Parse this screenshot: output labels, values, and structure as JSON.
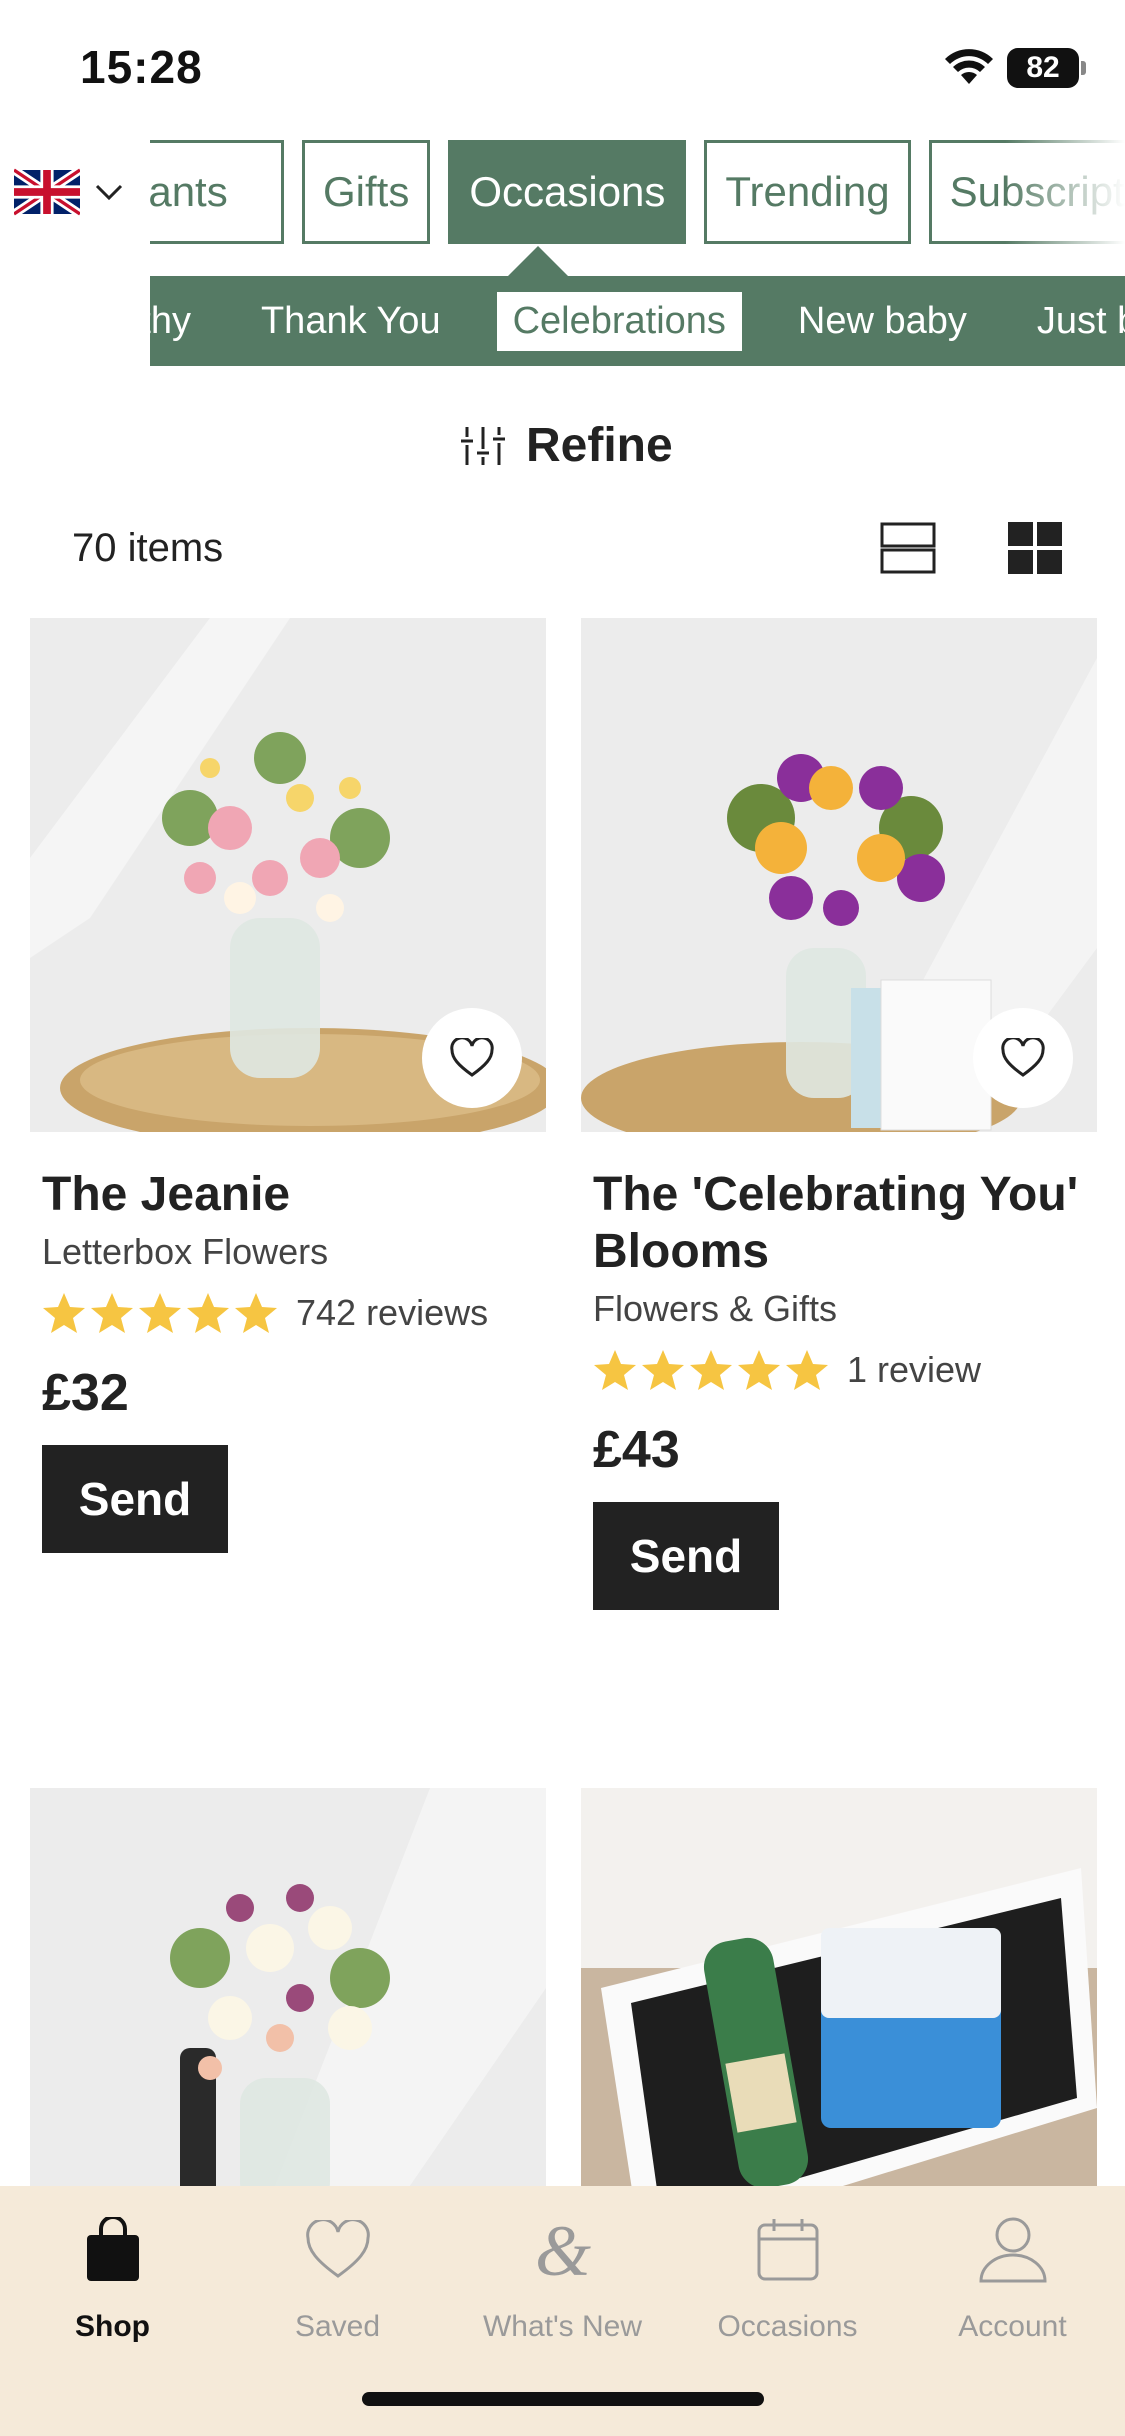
{
  "status_bar": {
    "time": "15:28",
    "battery": "82"
  },
  "colors": {
    "brand_green": "#557a64",
    "tabbar_bg": "#f5ead9",
    "star": "#f6c542"
  },
  "categories": [
    {
      "label": "Plants",
      "active": false
    },
    {
      "label": "Gifts",
      "active": false
    },
    {
      "label": "Occasions",
      "active": true
    },
    {
      "label": "Trending",
      "active": false
    },
    {
      "label": "Subscriptions",
      "active": false
    }
  ],
  "subcategories": [
    {
      "label": "Sympathy",
      "active": false
    },
    {
      "label": "Thank You",
      "active": false
    },
    {
      "label": "Celebrations",
      "active": true
    },
    {
      "label": "New baby",
      "active": false
    },
    {
      "label": "Just because",
      "active": false
    }
  ],
  "refine": {
    "label": "Refine"
  },
  "listing": {
    "items_count": "70 items"
  },
  "products": [
    {
      "title": "The Jeanie",
      "subtitle": "Letterbox Flowers",
      "rating": 5,
      "reviews": "742 reviews",
      "price": "£32",
      "cta": "Send"
    },
    {
      "title": "The 'Celebrating You' Blooms",
      "subtitle": "Flowers & Gifts",
      "rating": 5,
      "reviews": "1 review",
      "price": "£43",
      "cta": "Send"
    }
  ],
  "tabbar": {
    "shop": "Shop",
    "saved": "Saved",
    "whats_new": "What's New",
    "occasions": "Occasions",
    "account": "Account"
  }
}
